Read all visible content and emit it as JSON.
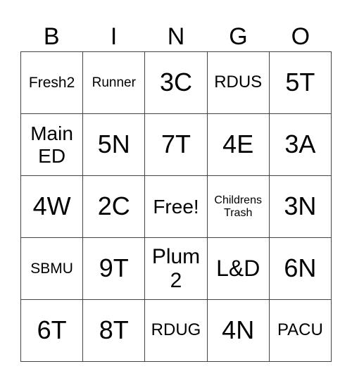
{
  "header": [
    "B",
    "I",
    "N",
    "G",
    "O"
  ],
  "cells": [
    [
      "Fresh2",
      "Runner",
      "3C",
      "RDUS",
      "5T"
    ],
    [
      "Main ED",
      "5N",
      "7T",
      "4E",
      "3A"
    ],
    [
      "4W",
      "2C",
      "Free!",
      "Childrens Trash",
      "3N"
    ],
    [
      "SBMU",
      "9T",
      "Plum 2",
      "L&D",
      "6N"
    ],
    [
      "6T",
      "8T",
      "RDUG",
      "4N",
      "PACU"
    ]
  ]
}
